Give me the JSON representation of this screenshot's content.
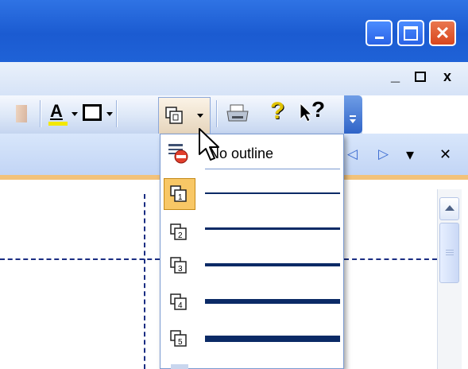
{
  "window": {
    "min_glyph": "–",
    "close_glyph": "✕"
  },
  "menubar": {
    "min_glyph": "_",
    "restore_glyph": "ꟸ",
    "close_glyph": "x"
  },
  "toolbar": {
    "font_color_glyph": "A",
    "help_glyph": "?",
    "whatsthis_glyph": "?"
  },
  "pane": {
    "nav_left": "◁",
    "nav_right": "▷",
    "menu": "▾",
    "close": "✕"
  },
  "outline_menu": {
    "no_outline_label": "No outline",
    "options": [
      {
        "label": "1",
        "thickness_px": 2
      },
      {
        "label": "2",
        "thickness_px": 3
      },
      {
        "label": "3",
        "thickness_px": 4
      },
      {
        "label": "4",
        "thickness_px": 6
      },
      {
        "label": "5",
        "thickness_px": 8
      }
    ],
    "selected_index": 0
  },
  "colors": {
    "titlebar": "#1b5bd1",
    "highlight": "#f8c766",
    "outline_line": "#0b2a66",
    "font_underline": "#f3e800"
  }
}
